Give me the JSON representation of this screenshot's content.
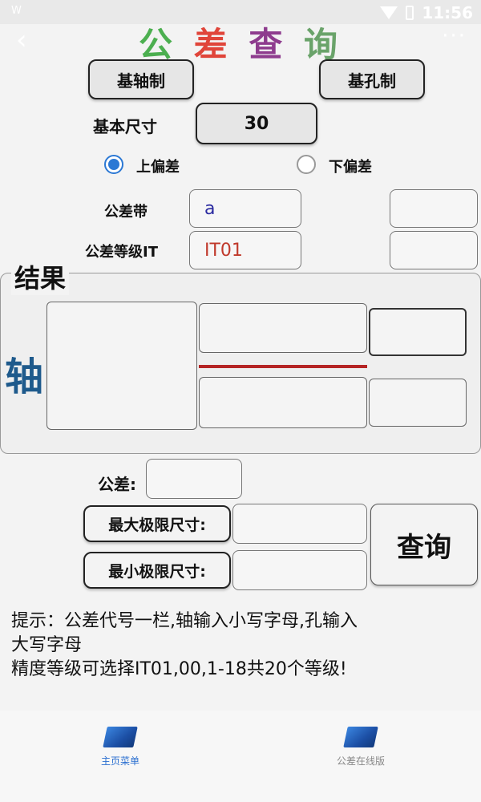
{
  "status": {
    "left_icon": "W",
    "time": "11:56"
  },
  "header": {
    "back_icon": "‹",
    "more_icon": "···",
    "title_chars": [
      "公",
      "差",
      "查",
      "询"
    ],
    "title_colors": [
      "#4caf50",
      "#e0453a",
      "#8e3c8e",
      "#6aa36a"
    ]
  },
  "system_buttons": {
    "shaft": "基轴制",
    "hole": "基孔制"
  },
  "basic_size": {
    "label": "基本尺寸",
    "value": "30"
  },
  "deviation": {
    "upper": "上偏差",
    "lower": "下偏差",
    "selected": "upper"
  },
  "tolerance_zone": {
    "label": "公差带",
    "value": "a",
    "value_color": "#2a2aa0",
    "value2": ""
  },
  "grade": {
    "label": "公差等级IT",
    "value": "IT01",
    "value_color": "#c0392b",
    "value2": ""
  },
  "result": {
    "title": "结果",
    "axis_label": "轴",
    "axis_color": "#1e5a8c"
  },
  "tolerance": {
    "label": "公差:",
    "value": ""
  },
  "max_limit": {
    "label": "最大极限尺寸:",
    "value": ""
  },
  "min_limit": {
    "label": "最小极限尺寸:",
    "value": ""
  },
  "query_button": "查询",
  "hint": [
    "提示：公差代号一栏,轴输入小写字母,孔输入",
    "大写字母",
    "精度等级可选择IT01,00,1-18共20个等级!"
  ],
  "bottom_nav": [
    {
      "label": "主页菜单",
      "active": true,
      "color": "#2b6fd0"
    },
    {
      "label": "公差在线版",
      "active": false,
      "color": "#888888"
    }
  ]
}
